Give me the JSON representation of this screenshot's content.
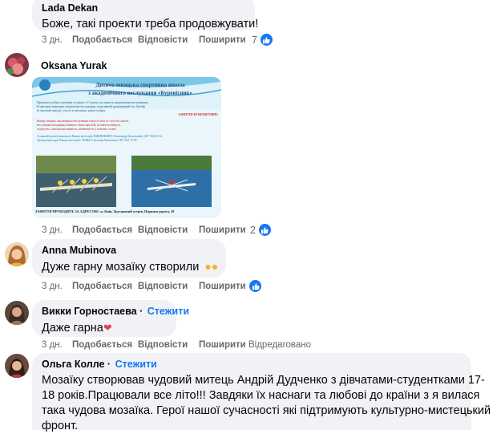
{
  "actions_labels": {
    "like": "Подобається",
    "reply": "Відповісти",
    "share": "Поширити",
    "edited": "Відредаговано"
  },
  "comments": [
    {
      "author": "Lada Dekan",
      "text": "Боже, такі проекти треба продовжувати!",
      "time": "3 дн.",
      "reaction_count": "7"
    },
    {
      "author": "Oksana Yurak",
      "time": "3 дн.",
      "reaction_count": "2",
      "poster": {
        "title1": "Дитячо-юнацька спортивна школа",
        "title2": "з академічного веслування «Буревісник»",
        "body_lines": [
          "Проводить набір хлопчиків та дівчат з 11 років для заняття академічним веслуванням.",
          "В програмі навчання: академічне веслування, спортивний тренажерний зал, басейн",
          "(в зимовий період), участь в змаганнях різного рівня."
        ],
        "free": "ЗАНЯТТЯ БЕЗКОШТОВНІ!",
        "red_lines": [
          "Кожну людину, яка вибрала веслування в якості хобі та способу життя,",
          "веслування неодмінно навчить таких якостей, як наполегливість,",
          "лідерство, самоорганізованість, впевненість у власних силах!"
        ],
        "contact1": "Старший тренер-викладач Вищої категорії: ЯЦЕНКЕВИЧ Олександр Васильович: 067 356 01 32",
        "contact2": "Тренер-викладач Вищої категорії: СЕНЬО Світлана Василівна: 067 322 79 09",
        "address": "ЗАНЯТТЯ ПРОХОДЯТЬ ЗА АДРЕСОЮ: м. Київ, Трухановий острів, Паркова дорога, 18"
      }
    },
    {
      "author": "Anna Mubinova",
      "text": "Дуже гарну мозаїку створили",
      "time": "3 дн."
    },
    {
      "author": "Викки Горностаева",
      "follow": "Стежити",
      "text": "Даже гарна",
      "time": "3 дн."
    },
    {
      "author": "Ольга Колле",
      "follow": "Стежити",
      "text_lines": [
        "Мозаїку створював чудовий митець Андрій Дудченко з дівчатами-студентками 17-",
        "18 років.Працювали все літо!!! Завдяки їх наснаги та любові до країни з я вилася",
        "така чудова мозаїка. Герої нашої сучасності які підтримують культурно-мистецький",
        "фронт."
      ]
    }
  ],
  "colors": {
    "bubble": "#f0f2f5",
    "link": "#1877f2",
    "meta": "#65676b",
    "text": "#050505"
  }
}
